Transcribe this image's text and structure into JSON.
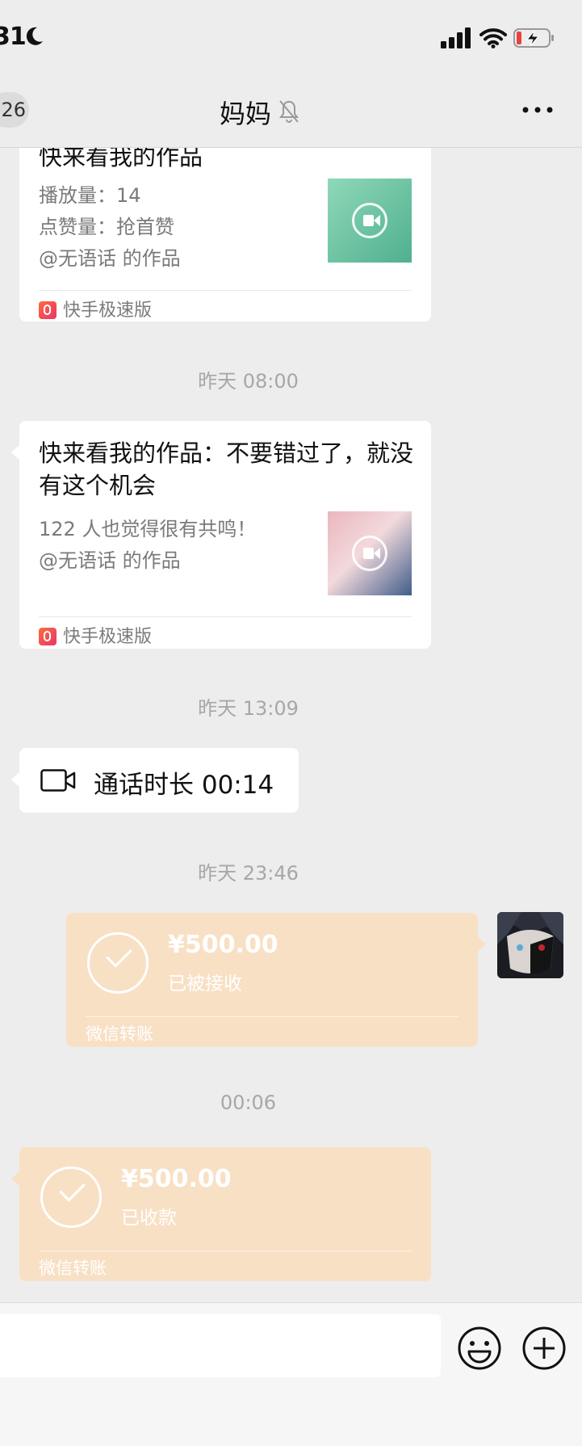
{
  "status_bar": {
    "time": "31"
  },
  "nav": {
    "unread_count": "26",
    "title": "妈妈"
  },
  "messages": {
    "card1": {
      "title": "快来看我的作品",
      "line1": "播放量：14",
      "line2": "点赞量：抢首赞",
      "line3": "@无语话 的作品",
      "app": "快手极速版"
    },
    "ts1": "昨天 08:00",
    "card2": {
      "title": "快来看我的作品：不要错过了，就没有这个机会",
      "line1": "122 人也觉得很有共鸣！",
      "line2": "@无语话 的作品",
      "app": "快手极速版"
    },
    "ts2": "昨天 13:09",
    "call": {
      "text": "通话时长 00:14"
    },
    "ts3": "昨天 23:46",
    "transfer_sent": {
      "amount": "¥500.00",
      "status": "已被接收",
      "brand": "微信转账"
    },
    "ts4": "00:06",
    "transfer_received": {
      "amount": "¥500.00",
      "status": "已收款",
      "brand": "微信转账"
    }
  },
  "colors": {
    "background": "#ededed",
    "transfer": "#f8e0c5",
    "bubble": "#ffffff"
  },
  "icons": [
    "moon-icon",
    "signal-icon",
    "wifi-icon",
    "battery-icon",
    "mute-icon",
    "more-icon",
    "video-call-icon",
    "check-icon",
    "emoji-icon",
    "plus-icon"
  ]
}
